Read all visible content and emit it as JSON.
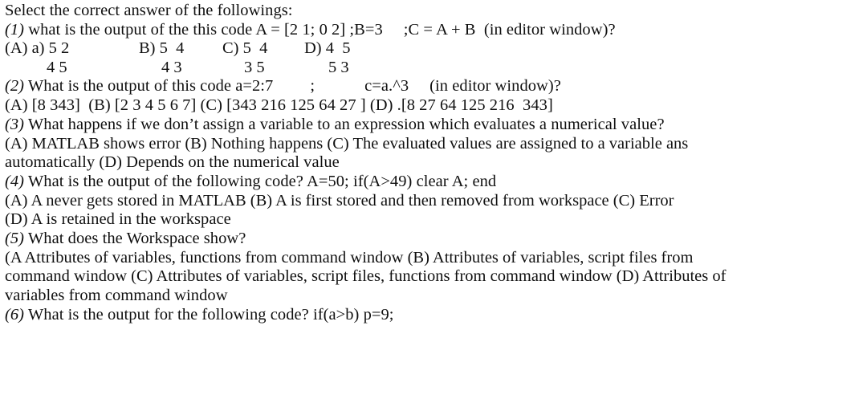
{
  "document": {
    "heading": "Select the correct answer of the followings:",
    "questions": [
      {
        "number": "(1)",
        "text": "what is the output of the this code A = [2 1; 0 2] ;B=3",
        "text_tail": ";C = A + B  (in editor window)?",
        "answer_style": "matrix",
        "options_row1": [
          {
            "label": "(A) a)",
            "value": "5 2"
          },
          {
            "label": "B)",
            "value": "5  4"
          },
          {
            "label": "C)",
            "value": "5  4"
          },
          {
            "label": "D)",
            "value": "4  5"
          }
        ],
        "options_row2": [
          {
            "value": "4 5"
          },
          {
            "value": "4 3"
          },
          {
            "value": "3 5"
          },
          {
            "value": "5 3"
          }
        ]
      },
      {
        "number": "(2)",
        "text": "What is the output of this code a=2:7",
        "code_sep": ";",
        "code_tail": "c=a.^3",
        "text_tail": "(in editor window)?",
        "answer_style": "inline",
        "options_line": "(A) [8 343]  (B) [2 3 4 5 6 7] (C) [343 216 125 64 27 ] (D) .[8 27 64 125 216  343]"
      },
      {
        "number": "(3)",
        "text": "What happens if we don’t assign a variable to an expression which evaluates a numerical value?",
        "answer_style": "justified",
        "options_justified": "(A) MATLAB shows error (B) Nothing happens (C) The evaluated values are assigned to a variable ans",
        "options_continuation": "automatically (D) Depends on the numerical value"
      },
      {
        "number": "(4)",
        "text": "What is the output of the following code? A=50; if(A>49) clear A; end",
        "answer_style": "justified",
        "options_justified": "(A) A never gets stored in MATLAB (B) A is first stored and then removed from workspace (C) Error",
        "options_continuation": "(D) A is retained in the workspace"
      },
      {
        "number": "(5)",
        "text": "What does the Workspace show?",
        "answer_style": "justified-multi",
        "options_justified": "(A Attributes of variables, functions from command window (B) Attributes of variables, script files from",
        "options_justified_2": "command window (C) Attributes of variables, script files, functions from command window (D) Attributes of",
        "options_continuation": "variables from command window"
      },
      {
        "number": "(6)",
        "text": "What is the output for the following code? if(a>b) p=9;",
        "answer_style": "none"
      }
    ]
  },
  "style": {
    "background_color": "#ffffff",
    "text_color": "#101010"
  }
}
